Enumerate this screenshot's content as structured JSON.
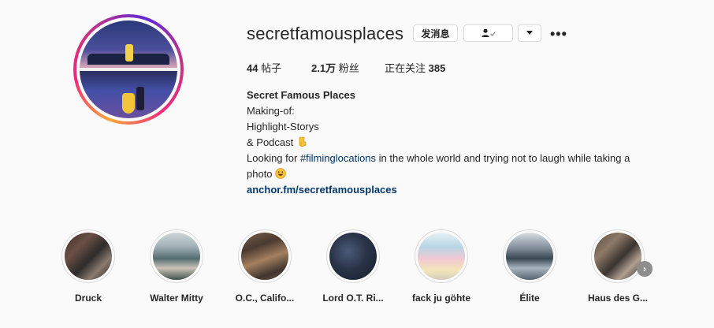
{
  "profile": {
    "username": "secretfamousplaces",
    "message_button": "发消息",
    "following_icon": "person-check-icon",
    "dropdown_icon": "triangle-down-icon",
    "more_icon": "ellipsis-icon",
    "more_glyph": "•••",
    "stats": {
      "posts_count": "44",
      "posts_label": " 帖子",
      "followers_count": "2.1万",
      "followers_label": " 粉丝",
      "following_label": "正在关注 ",
      "following_count": "385"
    },
    "bio": {
      "name": "Secret Famous Places",
      "line1": "Making-of:",
      "line2": "Highlight-Storys",
      "line3": "& Podcast",
      "line4_pre": "Looking for ",
      "hashtag": "#filminglocations",
      "line4_post": " in the whole world and trying not to laugh while taking a",
      "line5": "photo",
      "link": "anchor.fm/secretfamousplaces",
      "emoji_pointing": "pointing-down-hand-icon",
      "emoji_grin": "grinning-face-icon"
    }
  },
  "highlights": [
    {
      "label": "Druck"
    },
    {
      "label": "Walter Mitty"
    },
    {
      "label": "O.C., Califo..."
    },
    {
      "label": "Lord O.T. Ri..."
    },
    {
      "label": "fack ju göhte"
    },
    {
      "label": "Élite"
    },
    {
      "label": "Haus des G..."
    }
  ],
  "next_arrow": "›",
  "colors": {
    "link": "#00376b",
    "text": "#262626",
    "background": "#fafafa",
    "border": "#dbdbdb"
  }
}
